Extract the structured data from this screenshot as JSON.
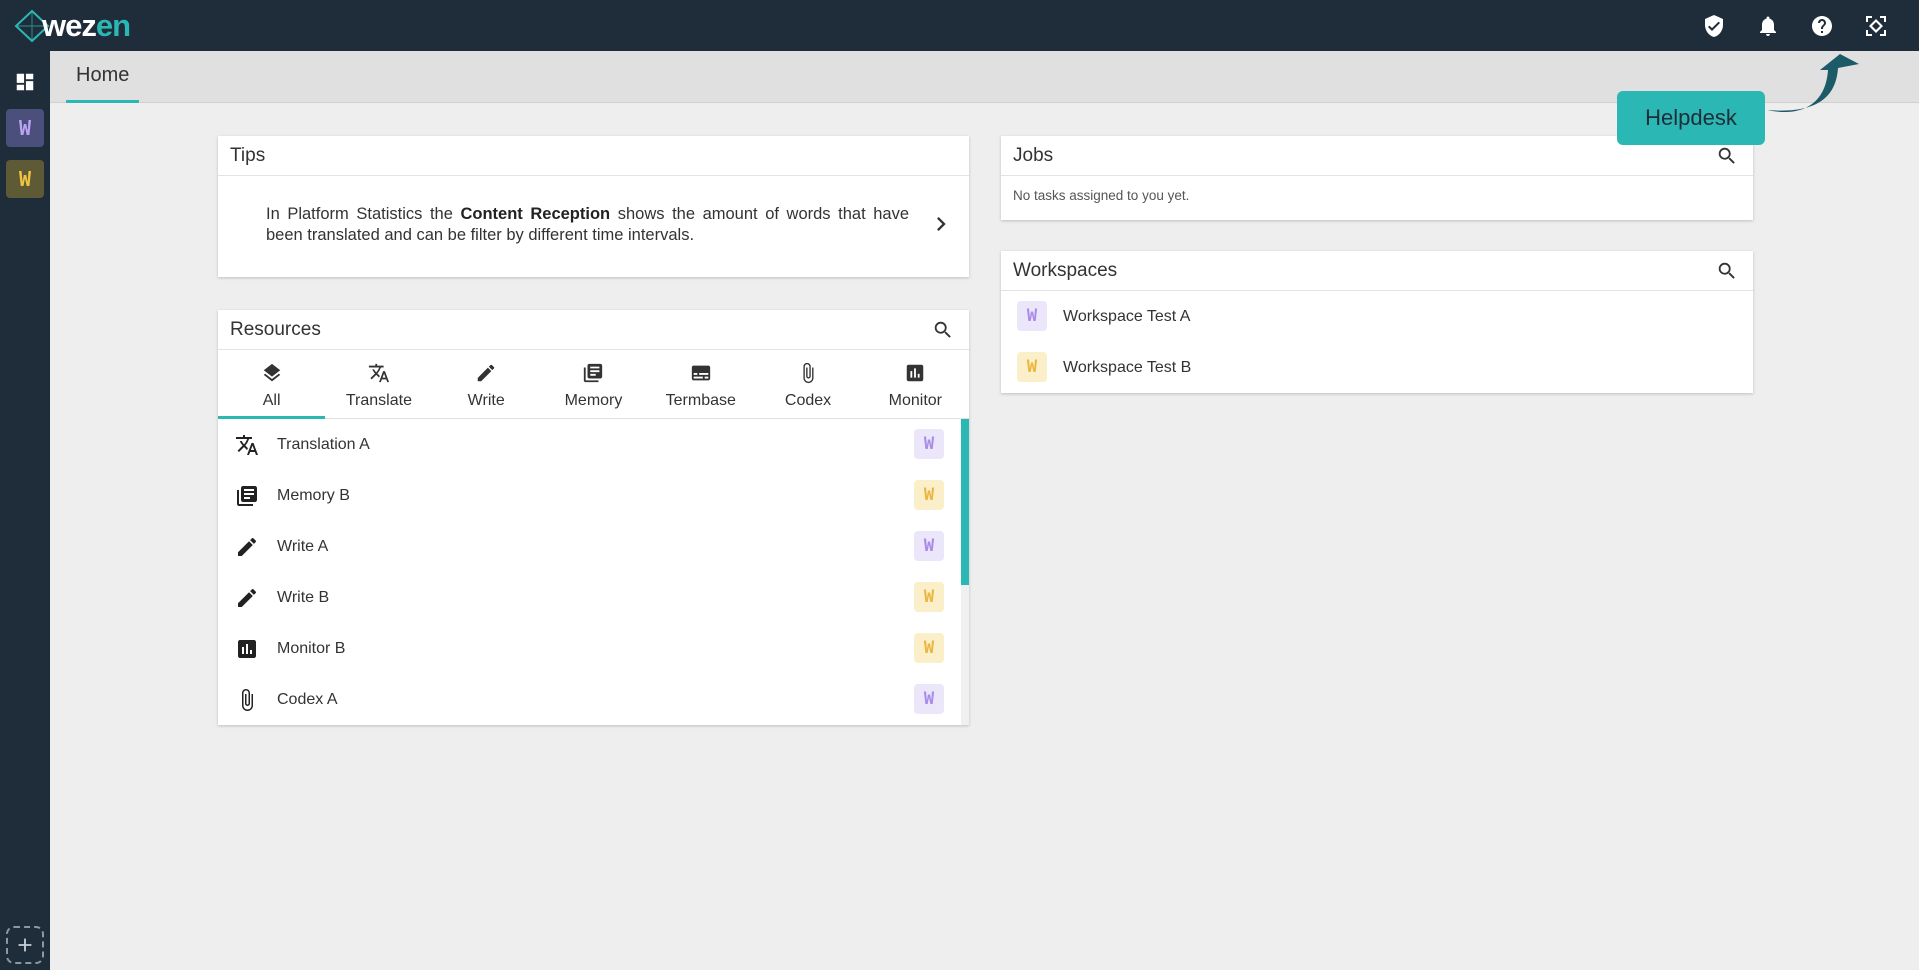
{
  "brand": {
    "logo_text_a": "wez",
    "logo_text_b": "en"
  },
  "topbar": {
    "icons": [
      "shield-icon",
      "bell-icon",
      "help-icon",
      "helpdesk-icon"
    ]
  },
  "tab": {
    "home": "Home"
  },
  "sidebar": {
    "dashboard_icon": "dashboard-icon",
    "workspaces": [
      {
        "letter": "W"
      },
      {
        "letter": "W"
      }
    ],
    "add_icon": "add-icon"
  },
  "tips": {
    "title": "Tips",
    "text_before": "In Platform Statistics the ",
    "text_bold": "Content Reception",
    "text_after": " shows the amount of words that have been translated and can be filter by different time intervals."
  },
  "resources": {
    "title": "Resources",
    "tabs": [
      {
        "label": "All",
        "icon": "layers-icon"
      },
      {
        "label": "Translate",
        "icon": "translate-icon"
      },
      {
        "label": "Write",
        "icon": "pencil-icon"
      },
      {
        "label": "Memory",
        "icon": "library-icon"
      },
      {
        "label": "Termbase",
        "icon": "subtitles-icon"
      },
      {
        "label": "Codex",
        "icon": "paperclip-icon"
      },
      {
        "label": "Monitor",
        "icon": "chart-icon"
      }
    ],
    "items": [
      {
        "name": "Translation A",
        "icon": "translate-icon",
        "badge": "W",
        "workspace": "a"
      },
      {
        "name": "Memory B",
        "icon": "library-icon",
        "badge": "W",
        "workspace": "b"
      },
      {
        "name": "Write A",
        "icon": "pencil-icon",
        "badge": "W",
        "workspace": "a"
      },
      {
        "name": "Write B",
        "icon": "pencil-icon",
        "badge": "W",
        "workspace": "b"
      },
      {
        "name": "Monitor B",
        "icon": "chart-icon",
        "badge": "W",
        "workspace": "b"
      },
      {
        "name": "Codex A",
        "icon": "paperclip-icon",
        "badge": "W",
        "workspace": "a"
      }
    ]
  },
  "jobs": {
    "title": "Jobs",
    "empty_text": "No tasks assigned to you yet."
  },
  "workspaces": {
    "title": "Workspaces",
    "items": [
      {
        "name": "Workspace Test A",
        "badge": "W"
      },
      {
        "name": "Workspace Test B",
        "badge": "W"
      }
    ]
  },
  "helpdesk": {
    "label": "Helpdesk"
  },
  "colors": {
    "accent": "#2bb7b3",
    "topbar": "#1f2d3a",
    "workspace_a": "#a98be8",
    "workspace_b": "#ebb640"
  }
}
